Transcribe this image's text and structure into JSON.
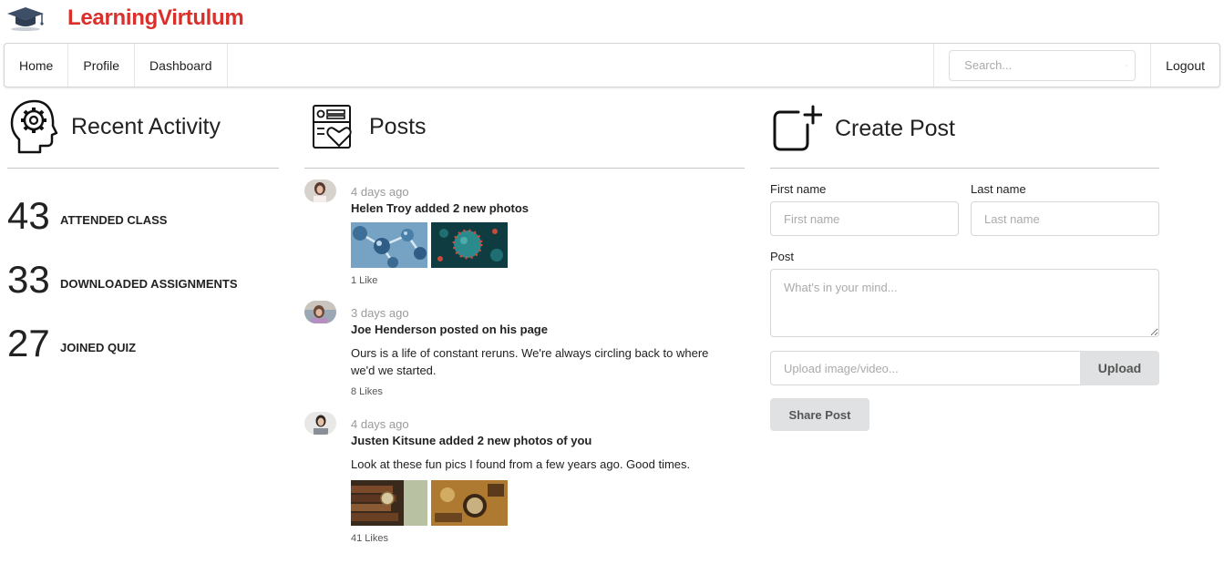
{
  "brand": {
    "name": "LearningVirtulum",
    "logo_icon": "graduation-cap-icon"
  },
  "navbar": {
    "items": [
      {
        "label": "Home"
      },
      {
        "label": "Profile"
      },
      {
        "label": "Dashboard"
      }
    ],
    "search": {
      "placeholder": "Search...",
      "icon": "search-icon"
    },
    "logout_label": "Logout"
  },
  "recent_activity": {
    "title": "Recent Activity",
    "icon": "head-gear-icon",
    "stats": [
      {
        "value": "43",
        "label": "ATTENDED CLASS"
      },
      {
        "value": "33",
        "label": "DOWNLOADED ASSIGNMENTS"
      },
      {
        "value": "27",
        "label": "JOINED QUIZ"
      }
    ]
  },
  "posts": {
    "title": "Posts",
    "icon": "post-heart-icon",
    "events": [
      {
        "date": "4 days ago",
        "summary": "Helen Troy added 2 new photos",
        "text": "",
        "likes": "1 Like"
      },
      {
        "date": "3 days ago",
        "summary": "Joe Henderson posted on his page",
        "text": "Ours is a life of constant reruns. We're always circling back to where we'd we started.",
        "likes": "8 Likes"
      },
      {
        "date": "4 days ago",
        "summary": "Justen Kitsune added 2 new photos of you",
        "text": "Look at these fun pics I found from a few years ago. Good times.",
        "likes": "41 Likes"
      }
    ]
  },
  "create_post": {
    "title": "Create Post",
    "icon": "square-plus-icon",
    "first_name": {
      "label": "First name",
      "placeholder": "First name"
    },
    "last_name": {
      "label": "Last name",
      "placeholder": "Last name"
    },
    "post": {
      "label": "Post",
      "placeholder": "What's in your mind..."
    },
    "upload": {
      "placeholder": "Upload image/video...",
      "button": "Upload"
    },
    "share_label": "Share Post"
  },
  "colors": {
    "brand": "#d9302c",
    "button_bg": "#e0e1e2",
    "border": "#d4d4d5"
  }
}
